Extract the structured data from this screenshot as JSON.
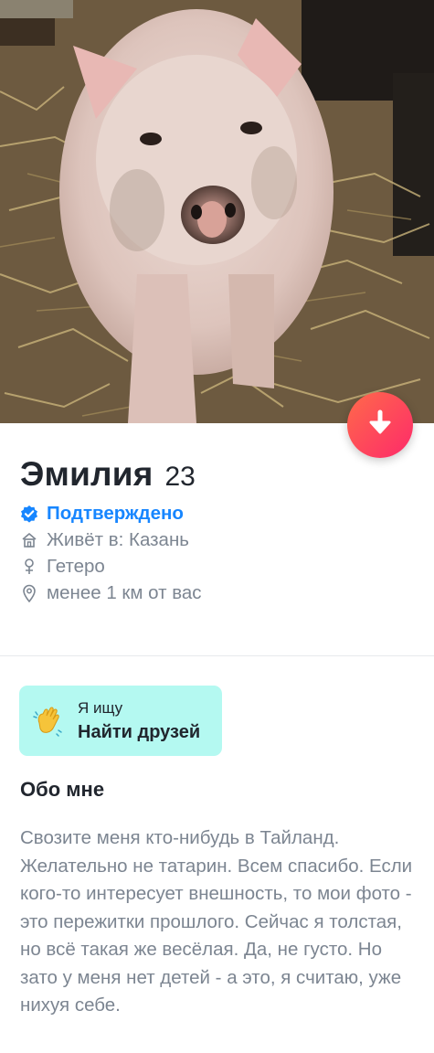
{
  "profile": {
    "name": "Эмилия",
    "age": "23",
    "verified": "Подтверждено",
    "lives": "Живёт в: Казань",
    "orientation": "Гетеро",
    "distance": "менее 1 км от вас"
  },
  "looking_for": {
    "label": "Я ищу",
    "value": "Найти друзей",
    "icon": "waving-hand-icon"
  },
  "about": {
    "title": "Обо мне",
    "text": "Свозите меня кто-нибудь в Тайланд. Желательно не татарин. Всем спасибо. Если кого-то интересует внешность, то мои фото - это пережитки прошлого. Сейчас я толстая, но всё такая же весёлая. Да, не густо. Но зато у меня нет детей - а это, я считаю, уже нихуя себе."
  },
  "colors": {
    "accent_gradient_start": "#ff6a4a",
    "accent_gradient_end": "#fd2a6a",
    "verified_blue": "#1786ff",
    "looking_bg": "#b4f9f1",
    "muted_text": "#7c8591"
  },
  "icons": [
    "arrow-down-icon",
    "verified-badge-icon",
    "home-icon",
    "gender-icon",
    "location-pin-icon",
    "waving-hand-icon"
  ]
}
